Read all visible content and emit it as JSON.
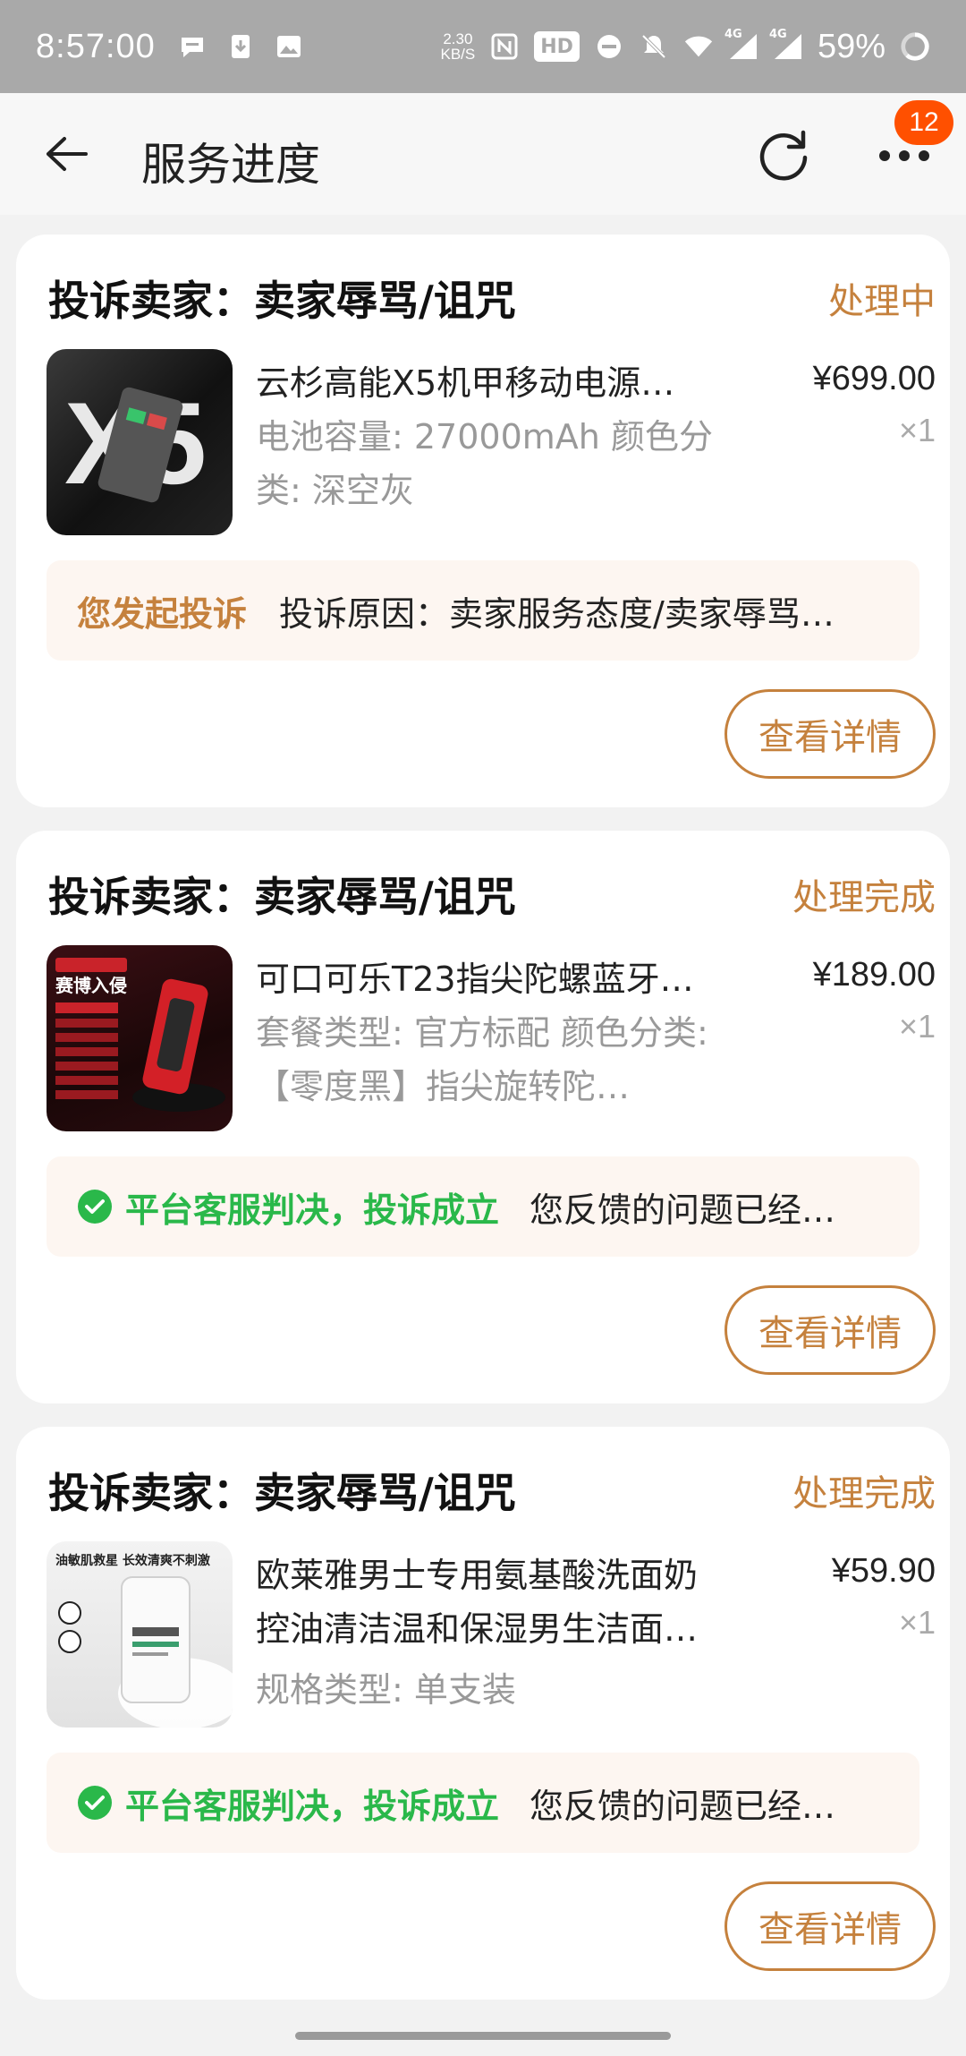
{
  "status_bar": {
    "time": "8:57:00",
    "net_speed_value": "2.30",
    "net_speed_unit": "KB/S",
    "hd_label": "HD",
    "signal_label_1": "4G",
    "signal_label_2": "4G",
    "battery": "59%"
  },
  "header": {
    "title": "服务进度",
    "badge_count": "12"
  },
  "cards": [
    {
      "title": "投诉卖家：卖家辱骂/诅咒",
      "status": "处理中",
      "product_title": "云杉高能X5机甲移动电源…",
      "spec": "电池容量: 27000mAh 颜色分类: 深空灰",
      "price": "¥699.00",
      "qty": "×1",
      "notice_label": "您发起投诉",
      "notice_text": "投诉原因：卖家服务态度/卖家辱骂…",
      "button": "查看详情",
      "thumb_text": "X5"
    },
    {
      "title": "投诉卖家：卖家辱骂/诅咒",
      "status": "处理完成",
      "product_title": "可口可乐T23指尖陀螺蓝牙…",
      "spec": "套餐类型: 官方标配 颜色分类: 【零度黑】指尖旋转陀…",
      "price": "¥189.00",
      "qty": "×1",
      "notice_label": "平台客服判决，投诉成立",
      "notice_text": "您反馈的问题已经…",
      "button": "查看详情",
      "thumb_text": "赛博入侵"
    },
    {
      "title": "投诉卖家：卖家辱骂/诅咒",
      "status": "处理完成",
      "product_title": "欧莱雅男士专用氨基酸洗面奶控油清洁温和保湿男生洁面…",
      "spec": "规格类型: 单支装",
      "price": "¥59.90",
      "qty": "×1",
      "notice_label": "平台客服判决，投诉成立",
      "notice_text": "您反馈的问题已经…",
      "button": "查看详情",
      "thumb_text": "油敏肌救星 长效清爽不刺激"
    }
  ],
  "colors": {
    "accent": "#c5813d",
    "success": "#2ab84a",
    "badge": "#ff5000"
  }
}
